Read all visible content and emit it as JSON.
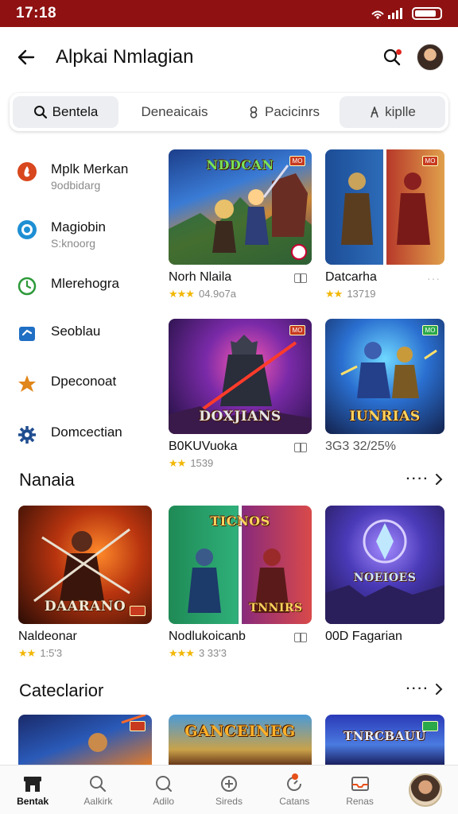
{
  "status": {
    "time": "17:18"
  },
  "header": {
    "title": "Alpkai Nmlagian"
  },
  "tabs": [
    {
      "label": "Bentela",
      "icon": "search-icon"
    },
    {
      "label": "Deneaicais",
      "icon": ""
    },
    {
      "label": "Pacicinrs",
      "icon": "refresh-icon"
    },
    {
      "label": "kiplle",
      "icon": "person-icon"
    }
  ],
  "categories": [
    {
      "label": "Mplk Merkan",
      "sub": "9odbidarg",
      "icon": "flame-icon",
      "color": "#d8471d"
    },
    {
      "label": "Magiobin",
      "sub": "S:knoorg",
      "icon": "ring-icon",
      "color": "#1e8fd4"
    },
    {
      "label": "Mlerehogra",
      "sub": "",
      "icon": "clock-icon",
      "color": "#2d9a3a"
    },
    {
      "label": "Seoblau",
      "sub": "",
      "icon": "flag-icon",
      "color": "#1f6fc4"
    },
    {
      "label": "Dpeconoat",
      "sub": "",
      "icon": "star-burst-icon",
      "color": "#e0861a"
    },
    {
      "label": "Domcectian",
      "sub": "",
      "icon": "gear-icon",
      "color": "#1f4c8f"
    }
  ],
  "featured": [
    {
      "title": "Norh Nlaila",
      "meta": "04.9o7a",
      "stars": "★★★",
      "thumb_text": "NDDCAN",
      "badge": "MO"
    },
    {
      "title": "Datcarha",
      "meta": "13719",
      "stars": "★★",
      "thumb_text": "",
      "badge": "MO"
    },
    {
      "title": "B0KUVuoka",
      "meta": "1539",
      "stars": "★★",
      "thumb_text": "DOXJIANS",
      "badge": "MO"
    },
    {
      "title": "3G3 32/25%",
      "meta": "",
      "stars": "",
      "thumb_text": "IUNRIAS",
      "badge": "MO"
    }
  ],
  "sections": [
    {
      "title": "Nanaia",
      "items": [
        {
          "title": "Naldeonar",
          "meta": "1:5'3",
          "stars": "★★",
          "thumb_text": "DAARANO"
        },
        {
          "title": "Nodlukoicanb",
          "meta": "3 33'3",
          "stars": "★★★",
          "thumb_text": "TICNOS",
          "thumb_text2": "TNNIRS"
        },
        {
          "title": "00D Fagarian",
          "meta": "",
          "stars": "",
          "thumb_text": "NOEIOES"
        }
      ]
    },
    {
      "title": "Cateclarior",
      "items": [
        {
          "title": "",
          "meta": "",
          "stars": "",
          "thumb_text": ""
        },
        {
          "title": "",
          "meta": "",
          "stars": "",
          "thumb_text": "GANCEINEG"
        },
        {
          "title": "",
          "meta": "",
          "stars": "",
          "thumb_text": "TNRCBAUU"
        }
      ]
    }
  ],
  "bottom_nav": [
    {
      "label": "Bentak",
      "icon": "store-icon",
      "active": true
    },
    {
      "label": "Aalkirk",
      "icon": "search-icon",
      "active": false
    },
    {
      "label": "Adilo",
      "icon": "search-icon",
      "active": false
    },
    {
      "label": "Sireds",
      "icon": "plus-circle-icon",
      "active": false
    },
    {
      "label": "Catans",
      "icon": "refresh-icon",
      "active": false
    },
    {
      "label": "Renas",
      "icon": "inbox-icon",
      "active": false
    }
  ],
  "colors": {
    "status_bar": "#8f1111",
    "star": "#f2b705",
    "accent_red": "#e0271f"
  }
}
